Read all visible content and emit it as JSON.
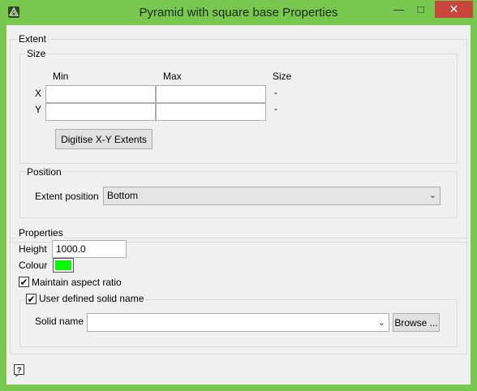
{
  "window": {
    "title": "Pyramid with square base Properties",
    "minimize_glyph": "—",
    "maximize_glyph": "□",
    "close_glyph": "✕",
    "title_bar_color": "#78c850",
    "close_color": "#c9463d"
  },
  "extent": {
    "group_label": "Extent",
    "size": {
      "group_label": "Size",
      "col_min": "Min",
      "col_max": "Max",
      "col_size": "Size",
      "rows": [
        {
          "label": "X",
          "min": "",
          "max": "",
          "size": "-"
        },
        {
          "label": "Y",
          "min": "",
          "max": "",
          "size": "-"
        }
      ],
      "digitise_button": "Digitise X-Y Extents"
    },
    "position": {
      "group_label": "Position",
      "extent_position_label": "Extent position",
      "extent_position_value": "Bottom"
    }
  },
  "properties": {
    "group_label": "Properties",
    "height_label": "Height",
    "height_value": "1000.0",
    "colour_label": "Colour",
    "colour_value": "#00ff00",
    "maintain_aspect_label": "Maintain aspect ratio",
    "maintain_aspect_checked": true,
    "user_defined": {
      "label": "User defined solid name",
      "checked": true,
      "solid_name_label": "Solid name",
      "solid_name_value": "",
      "browse_button": "Browse ..."
    }
  },
  "icons": {
    "app": "app-icon",
    "help": "help-icon"
  }
}
